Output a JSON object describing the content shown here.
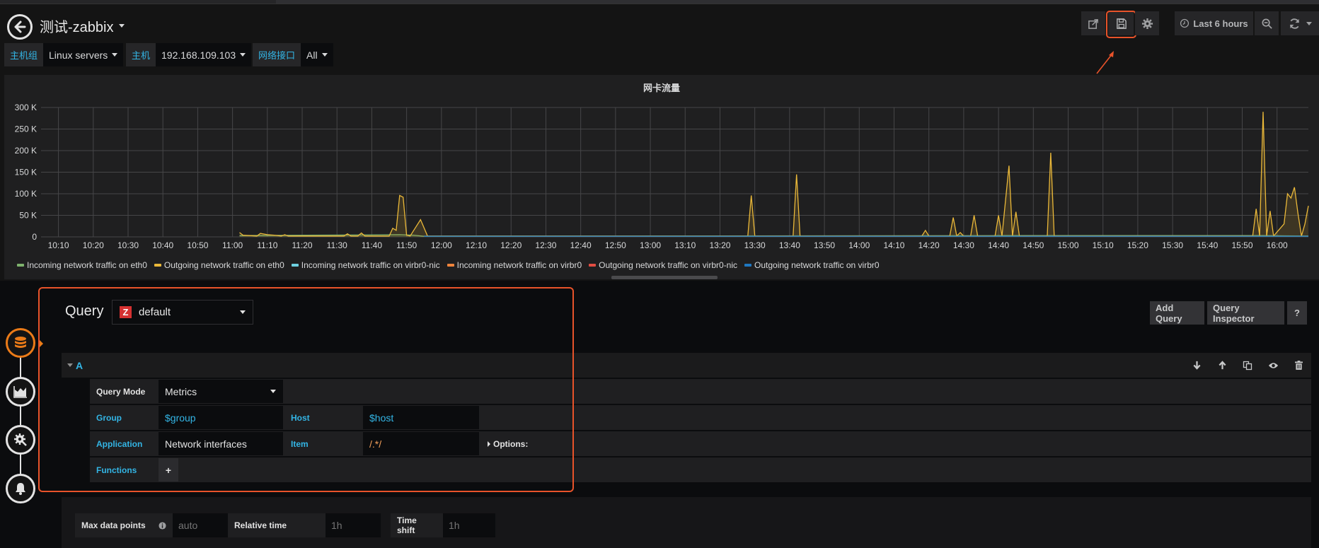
{
  "header": {
    "title": "测试-zabbix",
    "time_range": "Last 6 hours",
    "icons": [
      "back-arrow-icon",
      "share-icon",
      "save-icon",
      "settings-gear-icon",
      "clock-icon",
      "zoom-out-icon",
      "refresh-icon",
      "chevron-down-icon"
    ]
  },
  "variables": [
    {
      "label": "主机组",
      "value": "Linux servers"
    },
    {
      "label": "主机",
      "value": "192.168.109.103"
    },
    {
      "label": "网络接口",
      "value": "All"
    }
  ],
  "panel": {
    "title": "网卡流量"
  },
  "chart_data": {
    "type": "line",
    "title": "网卡流量",
    "xlabel": "",
    "ylabel": "",
    "ylim": [
      0,
      300000
    ],
    "yticks": [
      "0",
      "50 K",
      "100 K",
      "150 K",
      "200 K",
      "250 K",
      "300 K"
    ],
    "xlim": [
      "10:05",
      "16:09"
    ],
    "xticks": [
      "10:10",
      "10:20",
      "10:30",
      "10:40",
      "10:50",
      "11:00",
      "11:10",
      "11:20",
      "11:30",
      "11:40",
      "11:50",
      "12:00",
      "12:10",
      "12:20",
      "12:30",
      "12:40",
      "12:50",
      "13:00",
      "13:10",
      "13:20",
      "13:30",
      "13:40",
      "13:50",
      "14:00",
      "14:10",
      "14:20",
      "14:30",
      "14:40",
      "14:50",
      "15:00",
      "15:10",
      "15:20",
      "15:30",
      "15:40",
      "15:50",
      "16:00"
    ],
    "grid": true,
    "legend_position": "bottom",
    "series": [
      {
        "name": "Incoming network traffic on eth0",
        "color": "#7eb26d",
        "points": [
          [
            "11:02",
            3000
          ],
          [
            "11:48",
            5000
          ],
          [
            "11:52",
            4000
          ],
          [
            "11:55",
            1500
          ],
          [
            "14:42",
            3000
          ],
          [
            "15:56",
            3000
          ],
          [
            "16:02",
            2500
          ],
          [
            "16:09",
            2000
          ]
        ]
      },
      {
        "name": "Outgoing network traffic on eth0",
        "color": "#eab839",
        "points": [
          [
            "11:02",
            10000
          ],
          [
            "11:03",
            4000
          ],
          [
            "11:05",
            3000
          ],
          [
            "11:07",
            2000
          ],
          [
            "11:08",
            8000
          ],
          [
            "11:10",
            5000
          ],
          [
            "11:12",
            4000
          ],
          [
            "11:14",
            2000
          ],
          [
            "11:15",
            5000
          ],
          [
            "11:16",
            2000
          ],
          [
            "11:32",
            2000
          ],
          [
            "11:33",
            7000
          ],
          [
            "11:34",
            2000
          ],
          [
            "11:36",
            2000
          ],
          [
            "11:37",
            9000
          ],
          [
            "11:38",
            2000
          ],
          [
            "11:45",
            2000
          ],
          [
            "11:46",
            20000
          ],
          [
            "11:47",
            15000
          ],
          [
            "11:48",
            96000
          ],
          [
            "11:49",
            92000
          ],
          [
            "11:50",
            4000
          ],
          [
            "11:51",
            2000
          ],
          [
            "11:54",
            40000
          ],
          [
            "11:56",
            2000
          ],
          [
            "13:28",
            2000
          ],
          [
            "13:29",
            96000
          ],
          [
            "13:30",
            2000
          ],
          [
            "13:41",
            2000
          ],
          [
            "13:42",
            145000
          ],
          [
            "13:43",
            2000
          ],
          [
            "14:18",
            2000
          ],
          [
            "14:19",
            15000
          ],
          [
            "14:20",
            2000
          ],
          [
            "14:26",
            2000
          ],
          [
            "14:27",
            45000
          ],
          [
            "14:28",
            2000
          ],
          [
            "14:29",
            10000
          ],
          [
            "14:30",
            2000
          ],
          [
            "14:32",
            2000
          ],
          [
            "14:33",
            50000
          ],
          [
            "14:34",
            2000
          ],
          [
            "14:39",
            2000
          ],
          [
            "14:40",
            50000
          ],
          [
            "14:41",
            2000
          ],
          [
            "14:43",
            165000
          ],
          [
            "14:44",
            2000
          ],
          [
            "14:45",
            58000
          ],
          [
            "14:46",
            2000
          ],
          [
            "14:54",
            2000
          ],
          [
            "14:55",
            195000
          ],
          [
            "14:56",
            2000
          ],
          [
            "15:53",
            2000
          ],
          [
            "15:54",
            65000
          ],
          [
            "15:55",
            2000
          ],
          [
            "15:56",
            290000
          ],
          [
            "15:57",
            2000
          ],
          [
            "15:58",
            60000
          ],
          [
            "15:59",
            2000
          ],
          [
            "16:02",
            30000
          ],
          [
            "16:03",
            100000
          ],
          [
            "16:04",
            90000
          ],
          [
            "16:05",
            115000
          ],
          [
            "16:06",
            55000
          ],
          [
            "16:07",
            2000
          ],
          [
            "16:08",
            30000
          ],
          [
            "16:09",
            72000
          ]
        ]
      },
      {
        "name": "Incoming network traffic on virbr0-nic",
        "color": "#6ed0e0",
        "points": []
      },
      {
        "name": "Incoming network traffic on virbr0",
        "color": "#ef843c",
        "points": []
      },
      {
        "name": "Outgoing network traffic on virbr0-nic",
        "color": "#e24d42",
        "points": []
      },
      {
        "name": "Outgoing network traffic on virbr0",
        "color": "#1f78c1",
        "points": [
          [
            "11:55",
            1500
          ],
          [
            "16:09",
            1500
          ]
        ]
      }
    ]
  },
  "editor": {
    "query_label": "Query",
    "datasource": "default",
    "datasource_logo": "Z",
    "add_query": "Add Query",
    "query_inspector": "Query Inspector",
    "help": "?",
    "side_nav": [
      "database-icon",
      "area-chart-icon",
      "settings-wrench-icon",
      "bell-icon"
    ],
    "query": {
      "ref_id": "A",
      "query_mode_label": "Query Mode",
      "query_mode_value": "Metrics",
      "group_label": "Group",
      "group_value": "$group",
      "host_label": "Host",
      "host_value": "$host",
      "application_label": "Application",
      "application_value": "Network interfaces",
      "item_label": "Item",
      "item_value": "/.*/",
      "options_label": "Options:",
      "functions_label": "Functions",
      "add_function": "+"
    },
    "options": {
      "max_data_points_label": "Max data points",
      "max_data_points_placeholder": "auto",
      "relative_time_label": "Relative time",
      "relative_time_placeholder": "1h",
      "time_shift_label": "Time shift",
      "time_shift_placeholder": "1h"
    }
  }
}
